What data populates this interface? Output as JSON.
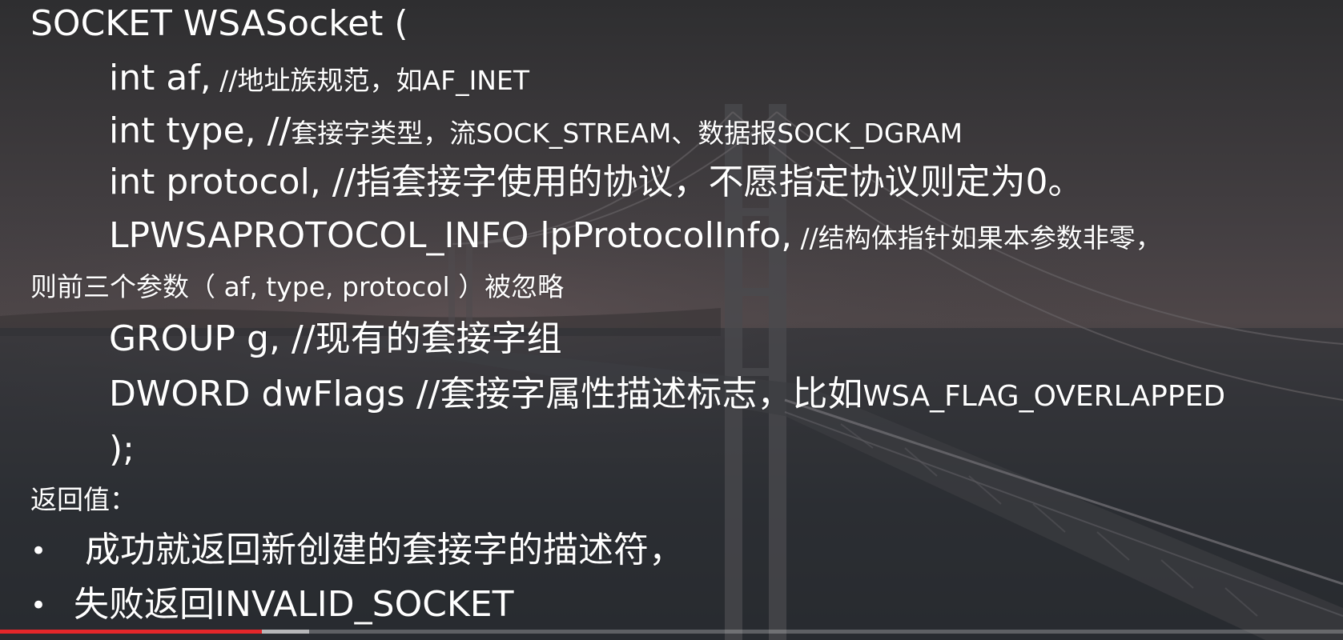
{
  "slide": {
    "title_line": "SOCKET WSASocket (",
    "params": [
      {
        "code": "int af,",
        "comment": " //地址族规范，如AF_INET"
      },
      {
        "code": "int type, //",
        "comment": "套接字类型，流SOCK_STREAM、数据报SOCK_DGRAM"
      },
      {
        "code": "int protocol, //指套接字使用的协议，不愿指定协议则定为0。",
        "comment": ""
      },
      {
        "code": "LPWSAPROTOCOL_INFO lpProtocolInfo,",
        "comment": " //结构体指针如果本参数非零，"
      },
      {
        "code": "GROUP g, //现有的套接字组",
        "comment": ""
      },
      {
        "code": "DWORD dwFlags //套接字属性描述标志，比如",
        "comment": "WSA_FLAG_OVERLAPPED"
      }
    ],
    "wrap_line": "则前三个参数（ af, type, protocol ）被忽略",
    "close_line": ");",
    "return_label": "返回值：",
    "bullets": [
      "成功就返回新创建的套接字的描述符，",
      "失败返回INVALID_SOCKET"
    ],
    "bullet_symbol": "•"
  },
  "player": {
    "progress_fraction": 0.195,
    "buffered_fraction": 0.23,
    "progress_color": "#e3262a"
  }
}
